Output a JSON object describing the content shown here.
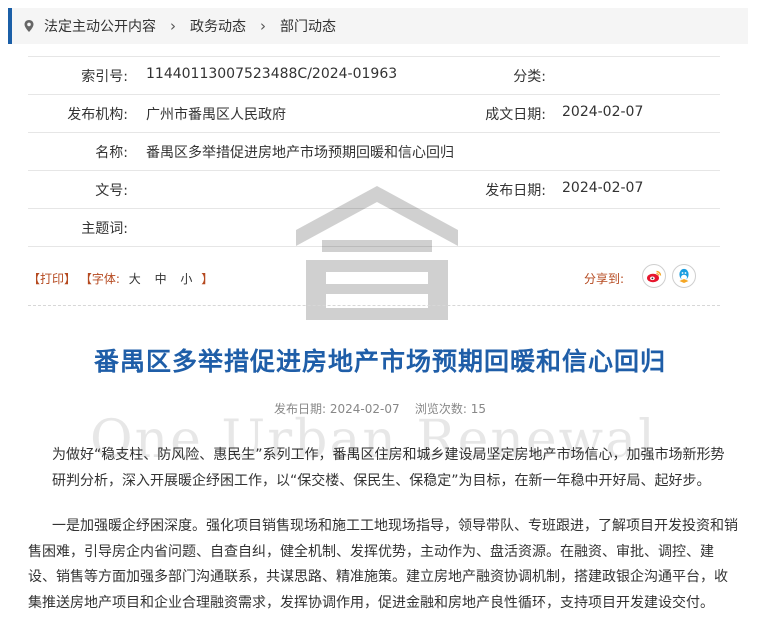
{
  "breadcrumb": {
    "items": [
      "法定主动公开内容",
      "政务动态",
      "部门动态"
    ],
    "separator": "›"
  },
  "meta": {
    "index_label": "索引号:",
    "index_value": "11440113007523488C/2024-01963",
    "category_label": "分类:",
    "category_value": "",
    "issuer_label": "发布机构:",
    "issuer_value": "广州市番禺区人民政府",
    "created_label": "成文日期:",
    "created_value": "2024-02-07",
    "name_label": "名称:",
    "name_value": "番禺区多举措促进房地产市场预期回暖和信心回归",
    "docno_label": "文号:",
    "docno_value": "",
    "published_label": "发布日期:",
    "published_value": "2024-02-07",
    "subject_label": "主题词:",
    "subject_value": ""
  },
  "tools": {
    "print": "【打印】",
    "font_prefix": "【字体:",
    "font_large": "大",
    "font_medium": "中",
    "font_small": "小",
    "font_suffix": "】",
    "share_label": "分享到:"
  },
  "watermark": {
    "text": "One Urban Renewal"
  },
  "article": {
    "title": "番禺区多举措促进房地产市场预期回暖和信心回归",
    "date_label": "发布日期:",
    "date_value": "2024-02-07",
    "views_label": "浏览次数:",
    "views_value": "15",
    "paragraph1": "为做好“稳支柱、防风险、惠民生”系列工作，番禺区住房和城乡建设局坚定房地产市场信心，加强市场新形势研判分析，深入开展暖企纾困工作，以“保交楼、保民生、保稳定”为目标，在新一年稳中开好局、起好步。",
    "paragraph2": "一是加强暖企纾困深度。强化项目销售现场和施工工地现场指导，领导带队、专班跟进，了解项目开发投资和销售困难，引导房企内省问题、自查自纠，健全机制、发挥优势，主动作为、盘活资源。在融资、审批、调控、建设、销售等方面加强多部门沟通联系，共谋思路、精准施策。建立房地产融资协调机制，搭建政银企沟通平台，收集推送房地产项目和企业合理融资需求，发挥协调作用，促进金融和房地产良性循环，支持项目开发建设交付。"
  },
  "colors": {
    "accent": "#1b5fa7",
    "title": "#1f5ea8",
    "tool_link": "#b5491f"
  }
}
